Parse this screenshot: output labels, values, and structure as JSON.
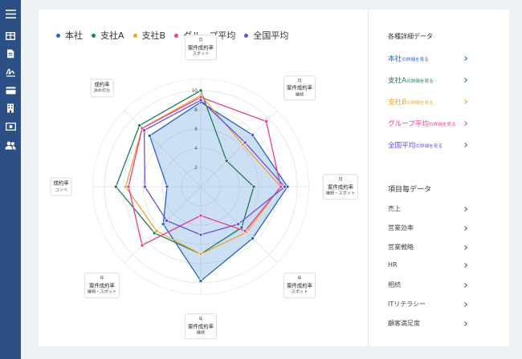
{
  "legend": [
    {
      "label": "本社",
      "color": "#2563c9"
    },
    {
      "label": "支社A",
      "color": "#1f7a5c"
    },
    {
      "label": "支社B",
      "color": "#f0a22e"
    },
    {
      "label": "グループ平均",
      "color": "#e83e8c"
    },
    {
      "label": "全国平均",
      "color": "#6b4ee0"
    }
  ],
  "chart_data": {
    "type": "radar",
    "max": 10,
    "ticks": [
      2,
      4,
      6,
      8,
      10
    ],
    "tick_labels": [
      "2",
      "4",
      "6",
      "8",
      "10"
    ],
    "axes": [
      {
        "period": "月",
        "label": "案件成約率",
        "sub": "スポット"
      },
      {
        "period": "月",
        "label": "案件成約率",
        "sub": "継続"
      },
      {
        "period": "月",
        "label": "案件成約率",
        "sub": "継続・スポット"
      },
      {
        "period": "年",
        "label": "案件成約率",
        "sub": "スポット"
      },
      {
        "period": "年",
        "label": "案件成約率",
        "sub": "継続"
      },
      {
        "period": "年",
        "label": "案件成約率",
        "sub": "継続・スポット"
      },
      {
        "period": "",
        "label": "成約率",
        "sub": "コンペ"
      },
      {
        "period": "",
        "label": "成約率",
        "sub": "決め打ち"
      }
    ],
    "series": [
      {
        "name": "本社",
        "color": "#2563c9",
        "fill": true,
        "values": [
          8.8,
          7.6,
          9.0,
          7.6,
          9.8,
          5.5,
          3.5,
          7.5
        ]
      },
      {
        "name": "支社A",
        "color": "#1f7a5c",
        "values": [
          10.0,
          3.8,
          5.5,
          6.0,
          7.0,
          6.8,
          8.8,
          9.0
        ]
      },
      {
        "name": "支社B",
        "color": "#f0a22e",
        "values": [
          9.5,
          6.2,
          8.3,
          6.7,
          7.0,
          6.5,
          7.8,
          8.6
        ]
      },
      {
        "name": "グループ平均",
        "color": "#e83e8c",
        "values": [
          9.3,
          9.6,
          8.3,
          6.5,
          3.0,
          8.6,
          7.5,
          8.6
        ]
      },
      {
        "name": "全国平均",
        "color": "#6b4ee0",
        "values": [
          9.0,
          6.5,
          8.7,
          5.5,
          5.0,
          5.0,
          5.8,
          8.3
        ]
      }
    ]
  },
  "panel": {
    "title": "各種詳細データ",
    "links": [
      {
        "main": "本社",
        "small": "の詳細を見る",
        "color": "#2563c9"
      },
      {
        "main": "支社A",
        "small": "の詳細を見る",
        "color": "#1f7a5c"
      },
      {
        "main": "支社B",
        "small": "の詳細を見る",
        "color": "#f0a22e"
      },
      {
        "main": "グループ平均",
        "small": "の詳細を見る",
        "color": "#e83e8c"
      },
      {
        "main": "全国平均",
        "small": "の詳細を見る",
        "color": "#6b4ee0"
      }
    ],
    "items_title": "項目毎データ",
    "items": [
      "売上",
      "営業効率",
      "営業戦略",
      "HR",
      "相続",
      "ITリテラシー",
      "顧客満足度"
    ]
  },
  "sidebar": {
    "icons": [
      "menu-icon",
      "table-icon",
      "document-icon",
      "signature-icon",
      "card-icon",
      "building-icon",
      "money-icon",
      "users-icon"
    ]
  }
}
